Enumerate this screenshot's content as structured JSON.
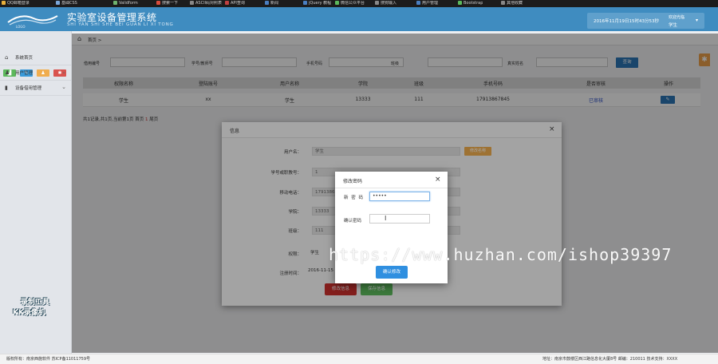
{
  "browser_tabs": [
    {
      "label": "QQ邮箱登录",
      "color": "#e9b03b"
    },
    {
      "label": "基础CSS",
      "color": "#7aa6d8"
    },
    {
      "label": "Validform",
      "color": "#6fb36f"
    },
    {
      "label": "搜索一下",
      "color": "#d84b3b"
    },
    {
      "label": "ASCII码对照表",
      "color": "#888888"
    },
    {
      "label": "API查询",
      "color": "#c04040"
    },
    {
      "label": "新闻",
      "color": "#4a7fc0"
    },
    {
      "label": "jQuery 教程",
      "color": "#4a7fc0"
    },
    {
      "label": "微信公众平台",
      "color": "#5cb85c"
    },
    {
      "label": "搜狗输入",
      "color": "#888888"
    },
    {
      "label": "用户管理",
      "color": "#4a7fc0"
    },
    {
      "label": "Bootstrap",
      "color": "#5cb85c"
    },
    {
      "label": "其他收藏",
      "color": "#888888"
    }
  ],
  "header": {
    "title": "实验室设备管理系统",
    "subtitle": "SHI YAN SHI SHE BEI GUAN LI XI TONG",
    "logo_text": "LOGO",
    "datetime": "2016年11月19日15时43分53秒",
    "user_greeting": "欢迎光临",
    "user_name": "学生"
  },
  "sidebar": {
    "quick_buttons": [
      {
        "name": "chart-icon",
        "color": "#5cb85c",
        "glyph": "▟"
      },
      {
        "name": "pencil-icon",
        "color": "#3a9ad9",
        "glyph": "✎"
      },
      {
        "name": "users-icon",
        "color": "#f0ad4e",
        "glyph": "♟"
      },
      {
        "name": "cogs-icon",
        "color": "#d9534f",
        "glyph": "✱"
      }
    ],
    "items": [
      {
        "label": "系统首页",
        "icon": "home-icon",
        "glyph": "⌂",
        "arrow": ""
      },
      {
        "label": "用户管理",
        "icon": "users-icon",
        "glyph": "♟",
        "arrow": "⌄"
      },
      {
        "label": "设备借用管理",
        "icon": "bookmark-icon",
        "glyph": "▮",
        "arrow": "⌄"
      }
    ]
  },
  "breadcrumb": {
    "home": "首页",
    "separator": ">"
  },
  "filters": [
    {
      "label": "借用编号"
    },
    {
      "label": "学号/教师号"
    },
    {
      "label": "手机号码"
    },
    {
      "label": "班级"
    },
    {
      "label": "真实姓名"
    }
  ],
  "search_button": "查询",
  "table": {
    "columns": [
      "权限名称",
      "登陆账号",
      "用户名称",
      "学院",
      "班级",
      "手机号码",
      "是否审核",
      "操作"
    ],
    "rows": [
      [
        "学生",
        "xx",
        "学生",
        "13333",
        "111",
        "17913867845",
        "已审核",
        "✎"
      ]
    ]
  },
  "pager": {
    "prefix": "共1记录,共1页,当前第1页 首页",
    "current": "1",
    "suffix": "尾页"
  },
  "info_modal": {
    "title": "信息",
    "close": "×",
    "fields": [
      {
        "label": "用户名：",
        "value": "学生"
      },
      {
        "label": "学号或职教号：",
        "value": "1"
      },
      {
        "label": "移动电话：",
        "value": "17913867845"
      },
      {
        "label": "学院：",
        "value": "13333"
      },
      {
        "label": "班级：",
        "value": "111"
      },
      {
        "label": "权限：",
        "value": "学生"
      },
      {
        "label": "注册时间：",
        "value": "2016-11-15"
      }
    ],
    "name_button": "修改名称",
    "modify_button": "修改信息",
    "save_button": "保存信息"
  },
  "password_modal": {
    "title": "修改密码",
    "close": "×",
    "new_label": "新 密 码",
    "new_value": "•••••",
    "confirm_label": "确认密码",
    "confirm_value": "",
    "submit": "确认修改"
  },
  "watermark": "https://www.huzhan.com/ishop39397",
  "recorder_badge": {
    "line1": "录制工具",
    "line2": "KK录像机"
  },
  "footer": {
    "left": "版权所有：南京西施软件  苏ICP备11011759号",
    "right": "地址：南京市鼓楼区西江路信息化大厦8号  邮编：210011  技术支持：XXXX"
  }
}
